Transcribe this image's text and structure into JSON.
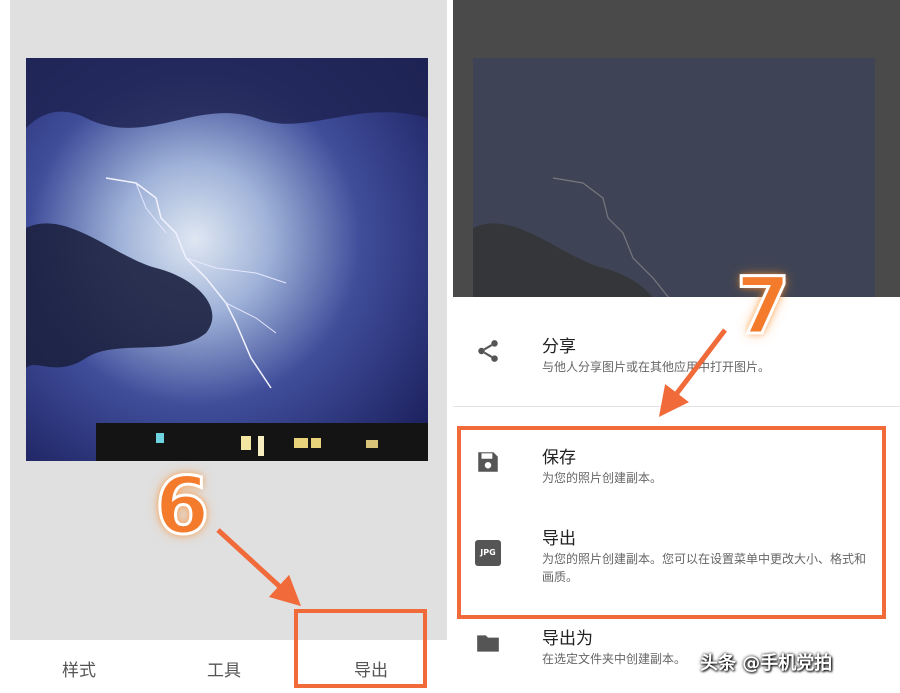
{
  "left": {
    "tabs": [
      {
        "label": "样式"
      },
      {
        "label": "工具"
      },
      {
        "label": "导出"
      }
    ]
  },
  "right": {
    "menu": [
      {
        "title": "分享",
        "desc": "与他人分享图片或在其他应用中打开图片。",
        "icon": "share-icon"
      },
      {
        "title": "保存",
        "desc": "为您的照片创建副本。",
        "icon": "save-icon"
      },
      {
        "title": "导出",
        "desc": "为您的照片创建副本。您可以在设置菜单中更改大小、格式和画质。",
        "icon": "jpg-icon",
        "icon_text": "JPG"
      },
      {
        "title": "导出为",
        "desc": "在选定文件夹中创建副本。",
        "icon": "folder-icon"
      }
    ]
  },
  "annotations": {
    "step1": "6",
    "step2": "7",
    "highlight_color": "#f06a3a",
    "number_color": "#f47a2c"
  },
  "watermark": "头条 @手机党拍"
}
